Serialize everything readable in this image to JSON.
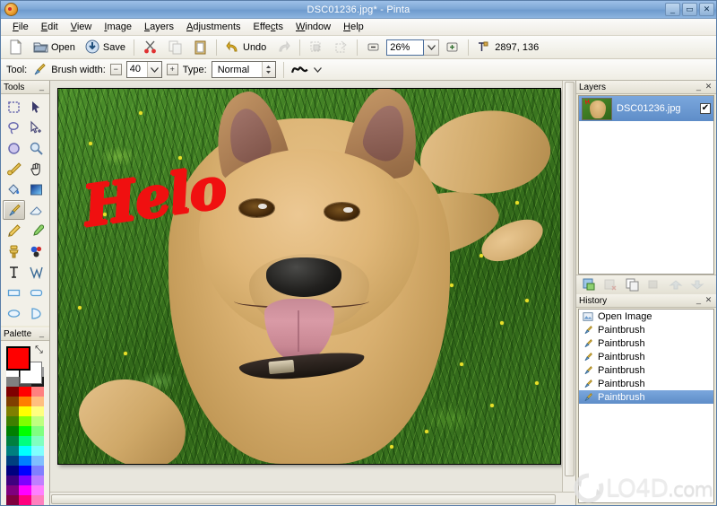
{
  "window": {
    "title": "DSC01236.jpg* - Pinta",
    "app_icon": "pinta-palette-icon",
    "minimize_label": "_",
    "maximize_label": "▭",
    "close_label": "✕"
  },
  "menubar": {
    "items": [
      {
        "label": "File",
        "mnemonic": "F"
      },
      {
        "label": "Edit",
        "mnemonic": "E"
      },
      {
        "label": "View",
        "mnemonic": "V"
      },
      {
        "label": "Image",
        "mnemonic": "I"
      },
      {
        "label": "Layers",
        "mnemonic": "L"
      },
      {
        "label": "Adjustments",
        "mnemonic": "A"
      },
      {
        "label": "Effects",
        "mnemonic": "c"
      },
      {
        "label": "Window",
        "mnemonic": "W"
      },
      {
        "label": "Help",
        "mnemonic": "H"
      }
    ]
  },
  "toolbar": {
    "new_label": "",
    "open_label": "Open",
    "save_label": "Save",
    "cut_label": "",
    "copy_label": "",
    "paste_label": "",
    "undo_label": "Undo",
    "redo_label": "",
    "crop_label": "",
    "deselect_label": "",
    "zoom_out_label": "",
    "zoom_value": "26%",
    "zoom_in_label": "",
    "coordinates": "2897, 136"
  },
  "tool_options": {
    "tool_label": "Tool:",
    "tool_icon": "paintbrush-icon",
    "brush_width_label": "Brush width:",
    "brush_width_value": "40",
    "decrease_label": "−",
    "increase_label": "+",
    "type_label": "Type:",
    "type_value": "Normal",
    "blend_icon": "curve-icon"
  },
  "tools_panel": {
    "title": "Tools",
    "collapse_label": "_",
    "tools": [
      {
        "name": "rectangle-select-tool",
        "selected": false
      },
      {
        "name": "move-selected-tool",
        "selected": false
      },
      {
        "name": "lasso-select-tool",
        "selected": false
      },
      {
        "name": "move-selection-tool",
        "selected": false
      },
      {
        "name": "ellipse-select-tool",
        "selected": false
      },
      {
        "name": "zoom-tool",
        "selected": false
      },
      {
        "name": "magic-wand-tool",
        "selected": false
      },
      {
        "name": "pan-tool",
        "selected": false
      },
      {
        "name": "paint-bucket-tool",
        "selected": false
      },
      {
        "name": "gradient-tool",
        "selected": false
      },
      {
        "name": "paintbrush-tool",
        "selected": true
      },
      {
        "name": "eraser-tool",
        "selected": false
      },
      {
        "name": "pencil-tool",
        "selected": false
      },
      {
        "name": "color-picker-tool",
        "selected": false
      },
      {
        "name": "clone-stamp-tool",
        "selected": false
      },
      {
        "name": "recolor-tool",
        "selected": false
      },
      {
        "name": "text-tool",
        "selected": false
      },
      {
        "name": "line-curve-tool",
        "selected": false
      },
      {
        "name": "rectangle-tool",
        "selected": false
      },
      {
        "name": "rounded-rectangle-tool",
        "selected": false
      },
      {
        "name": "ellipse-tool",
        "selected": false
      },
      {
        "name": "freeform-shape-tool",
        "selected": false
      }
    ]
  },
  "palette_panel": {
    "title": "Palette",
    "collapse_label": "_",
    "primary_color": "#ff0000",
    "secondary_color": "#ffffff",
    "swap_icon": "swap-colors-icon",
    "swatches": [
      "#ffffff",
      "#000000",
      "#9a9a9a",
      "#808080",
      "#4d4d4d",
      "#1a1a1a",
      "#7f0000",
      "#ff0000",
      "#ff8080",
      "#7f3f00",
      "#ff7f00",
      "#ffbf80",
      "#7f7f00",
      "#ffff00",
      "#ffff80",
      "#3f7f00",
      "#7fff00",
      "#bfff80",
      "#007f00",
      "#00ff00",
      "#80ff80",
      "#007f3f",
      "#00ff7f",
      "#80ffbf",
      "#007f7f",
      "#00ffff",
      "#80ffff",
      "#003f7f",
      "#007fff",
      "#80bfff",
      "#00007f",
      "#0000ff",
      "#8080ff",
      "#3f007f",
      "#7f00ff",
      "#bf80ff",
      "#7f007f",
      "#ff00ff",
      "#ff80ff",
      "#7f003f",
      "#ff007f",
      "#ff80bf"
    ]
  },
  "canvas": {
    "image_name": "DSC01236.jpg",
    "annotation_text": "Helo",
    "annotation_color": "#f01010"
  },
  "layers_panel": {
    "title": "Layers",
    "collapse_label": "_",
    "close_label": "✕",
    "layers": [
      {
        "name": "DSC01236.jpg",
        "visible": true,
        "selected": true,
        "check_glyph": "✔"
      }
    ],
    "buttons": [
      {
        "name": "add-layer-button",
        "enabled": true
      },
      {
        "name": "delete-layer-button",
        "enabled": false
      },
      {
        "name": "duplicate-layer-button",
        "enabled": true
      },
      {
        "name": "merge-layer-down-button",
        "enabled": false
      },
      {
        "name": "move-layer-up-button",
        "enabled": false
      },
      {
        "name": "move-layer-down-button",
        "enabled": false
      }
    ]
  },
  "history_panel": {
    "title": "History",
    "collapse_label": "_",
    "close_label": "✕",
    "items": [
      {
        "label": "Open Image",
        "icon": "open-image-icon",
        "selected": false
      },
      {
        "label": "Paintbrush",
        "icon": "paintbrush-icon",
        "selected": false
      },
      {
        "label": "Paintbrush",
        "icon": "paintbrush-icon",
        "selected": false
      },
      {
        "label": "Paintbrush",
        "icon": "paintbrush-icon",
        "selected": false
      },
      {
        "label": "Paintbrush",
        "icon": "paintbrush-icon",
        "selected": false
      },
      {
        "label": "Paintbrush",
        "icon": "paintbrush-icon",
        "selected": false
      },
      {
        "label": "Paintbrush",
        "icon": "paintbrush-icon",
        "selected": true
      }
    ]
  },
  "watermark": {
    "text": "LO4D",
    "suffix": ".com"
  }
}
